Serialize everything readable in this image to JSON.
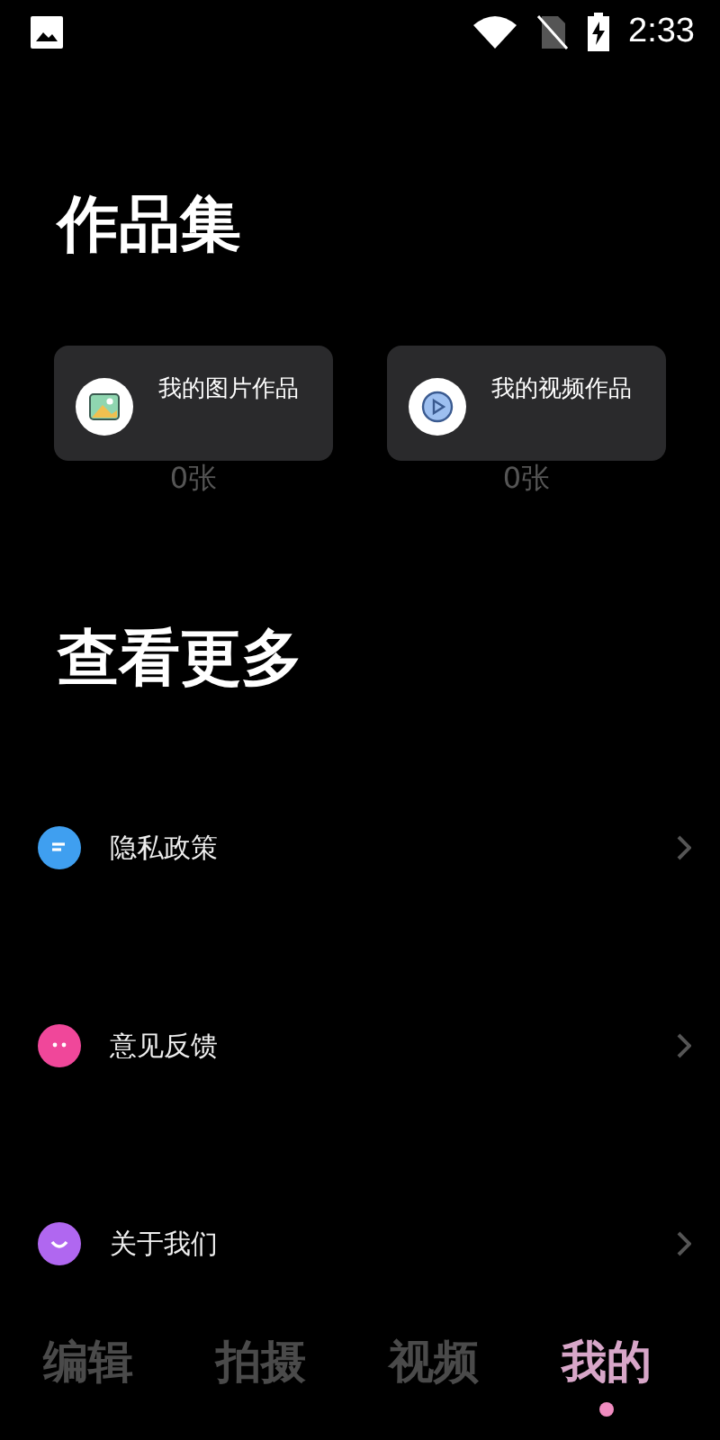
{
  "status_bar": {
    "time": "2:33"
  },
  "works": {
    "title": "作品集",
    "cards": [
      {
        "kind": "image",
        "label": "我的图片作品",
        "count": "0张"
      },
      {
        "kind": "video",
        "label": "我的视频作品",
        "count": "0张"
      }
    ]
  },
  "more": {
    "title": "查看更多",
    "items": [
      {
        "kind": "privacy",
        "label": "隐私政策",
        "color": "#3f9ff0"
      },
      {
        "kind": "feedback",
        "label": "意见反馈",
        "color": "#f0479a"
      },
      {
        "kind": "about",
        "label": "关于我们",
        "color": "#b067f0"
      }
    ]
  },
  "tabs": [
    {
      "label": "编辑",
      "selected": false
    },
    {
      "label": "拍摄",
      "selected": false
    },
    {
      "label": "视频",
      "selected": false
    },
    {
      "label": "我的",
      "selected": true
    }
  ]
}
